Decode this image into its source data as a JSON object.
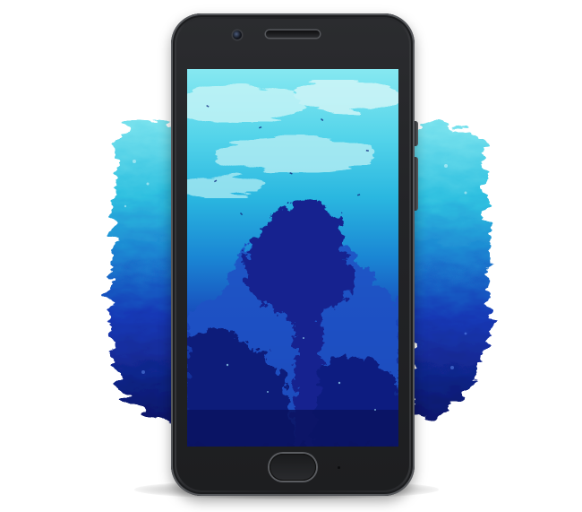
{
  "scene": {
    "subject": "smartphone-on-blue-paint-splash",
    "background_color": "#ffffff",
    "phone_color": "#232427",
    "wallpaper_colors": {
      "sky_light": "#7fe6f0",
      "sky_mid": "#38c6e2",
      "mid_teal": "#1f9fd6",
      "deep_blue": "#1834b8",
      "navy": "#0b1670"
    },
    "icons": [
      "front-camera-icon",
      "speaker-grille-icon",
      "home-button-icon"
    ]
  }
}
